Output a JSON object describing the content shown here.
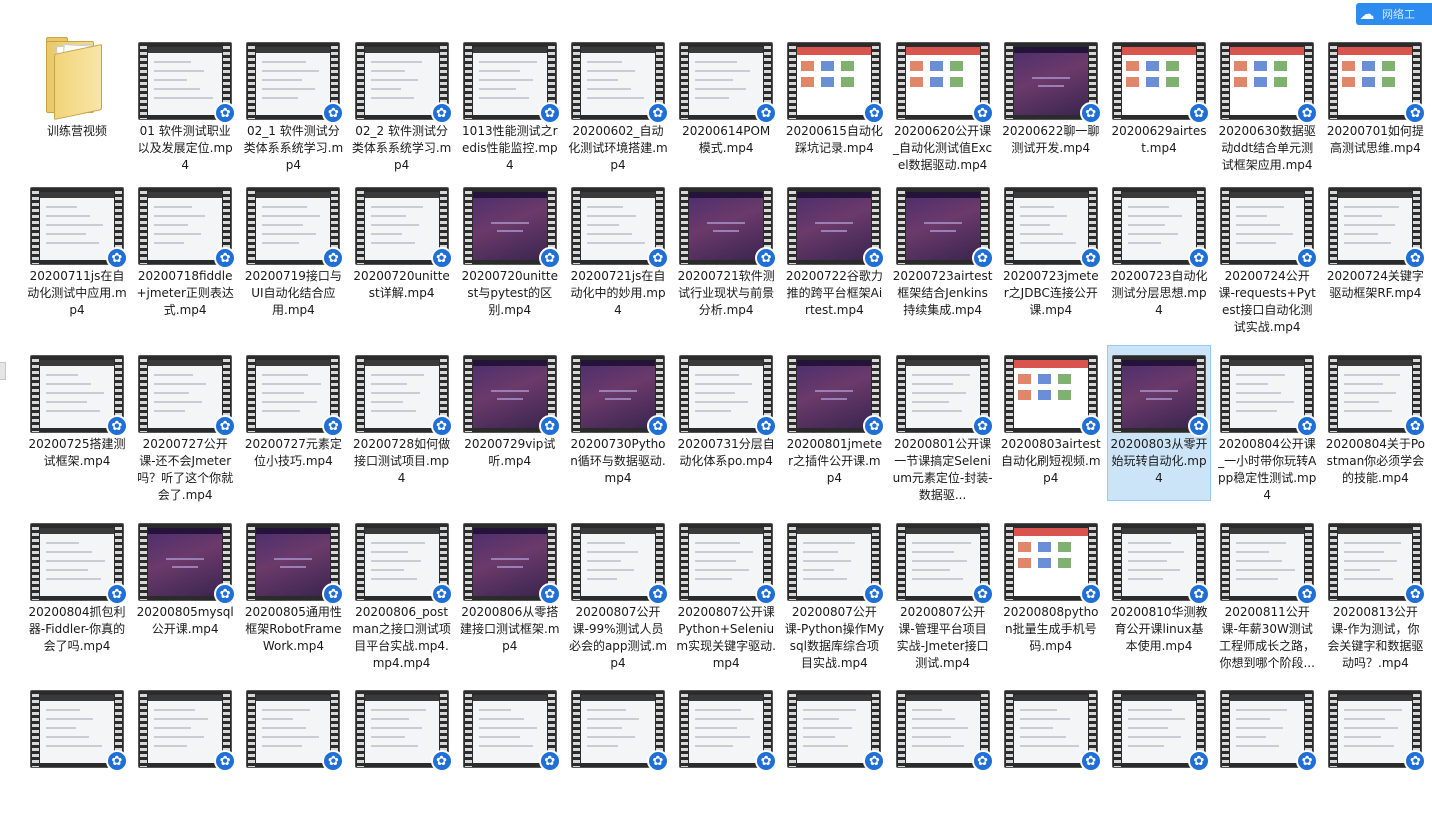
{
  "widget": {
    "icon": "cloud-icon",
    "label": "网络工"
  },
  "files": [
    {
      "name": "训练营视频",
      "type": "folder",
      "style": "folder"
    },
    {
      "name": "01 软件测试职业以及发展定位.mp4",
      "type": "video",
      "style": "light"
    },
    {
      "name": "02_1 软件测试分类体系系统学习.mp4",
      "type": "video",
      "style": "light"
    },
    {
      "name": "02_2 软件测试分类体系系统学习.mp4",
      "type": "video",
      "style": "light"
    },
    {
      "name": "1013性能测试之redis性能监控.mp4",
      "type": "video",
      "style": "light"
    },
    {
      "name": "20200602_自动化测试环境搭建.mp4",
      "type": "video",
      "style": "light"
    },
    {
      "name": "20200614POM模式.mp4",
      "type": "video",
      "style": "light"
    },
    {
      "name": "20200615自动化踩坑记录.mp4",
      "type": "video",
      "style": "web"
    },
    {
      "name": "20200620公开课_自动化测试值Excel数据驱动.mp4",
      "type": "video",
      "style": "web"
    },
    {
      "name": "20200622聊一聊测试开发.mp4",
      "type": "video",
      "style": "dark"
    },
    {
      "name": "20200629airtest.mp4",
      "type": "video",
      "style": "web"
    },
    {
      "name": "20200630数据驱动ddt结合单元测试框架应用.mp4",
      "type": "video",
      "style": "web"
    },
    {
      "name": "20200701如何提高测试思维.mp4",
      "type": "video",
      "style": "web"
    },
    {
      "name": "20200711js在自动化测试中应用.mp4",
      "type": "video",
      "style": "light"
    },
    {
      "name": "20200718fiddle+jmeter正则表达式.mp4",
      "type": "video",
      "style": "light"
    },
    {
      "name": "20200719接口与UI自动化结合应用.mp4",
      "type": "video",
      "style": "light"
    },
    {
      "name": "20200720unittest详解.mp4",
      "type": "video",
      "style": "light"
    },
    {
      "name": "20200720unittest与pytest的区别.mp4",
      "type": "video",
      "style": "dark"
    },
    {
      "name": "20200721js在自动化中的妙用.mp4",
      "type": "video",
      "style": "light"
    },
    {
      "name": "20200721软件测试行业现状与前景分析.mp4",
      "type": "video",
      "style": "dark"
    },
    {
      "name": "20200722谷歌力推的跨平台框架Airtest.mp4",
      "type": "video",
      "style": "dark"
    },
    {
      "name": "20200723airtest框架结合Jenkins持续集成.mp4",
      "type": "video",
      "style": "dark"
    },
    {
      "name": "20200723jmeter之JDBC连接公开课.mp4",
      "type": "video",
      "style": "light"
    },
    {
      "name": "20200723自动化测试分层思想.mp4",
      "type": "video",
      "style": "light"
    },
    {
      "name": "20200724公开课-requests+Pytest接口自动化测试实战.mp4",
      "type": "video",
      "style": "light"
    },
    {
      "name": "20200724关键字驱动框架RF.mp4",
      "type": "video",
      "style": "light"
    },
    {
      "name": "20200725搭建测试框架.mp4",
      "type": "video",
      "style": "light"
    },
    {
      "name": "20200727公开课-还不会Jmeter吗？听了这个你就会了.mp4",
      "type": "video",
      "style": "light"
    },
    {
      "name": "20200727元素定位小技巧.mp4",
      "type": "video",
      "style": "light"
    },
    {
      "name": "20200728如何做接口测试项目.mp4",
      "type": "video",
      "style": "light"
    },
    {
      "name": "20200729vip试听.mp4",
      "type": "video",
      "style": "dark"
    },
    {
      "name": "20200730Python循环与数据驱动.mp4",
      "type": "video",
      "style": "dark"
    },
    {
      "name": "20200731分层自动化体系po.mp4",
      "type": "video",
      "style": "light"
    },
    {
      "name": "20200801jmeter之插件公开课.mp4",
      "type": "video",
      "style": "dark"
    },
    {
      "name": "20200801公开课一节课搞定Selenium元素定位-封装-数据驱...",
      "type": "video",
      "style": "light"
    },
    {
      "name": "20200803airtest自动化刷短视频.mp4",
      "type": "video",
      "style": "web"
    },
    {
      "name": "20200803从零开始玩转自动化.mp4",
      "type": "video",
      "style": "dark",
      "selected": true
    },
    {
      "name": "20200804公开课_一小时带你玩转App稳定性测试.mp4",
      "type": "video",
      "style": "light"
    },
    {
      "name": "20200804关于Postman你必须学会的技能.mp4",
      "type": "video",
      "style": "light"
    },
    {
      "name": "20200804抓包利器-Fiddler-你真的会了吗.mp4",
      "type": "video",
      "style": "light"
    },
    {
      "name": "20200805mysql公开课.mp4",
      "type": "video",
      "style": "dark"
    },
    {
      "name": "20200805通用性框架RobotFrameWork.mp4",
      "type": "video",
      "style": "dark"
    },
    {
      "name": "20200806_postman之接口测试项目平台实战.mp4.mp4.mp4",
      "type": "video",
      "style": "light"
    },
    {
      "name": "20200806从零搭建接口测试框架.mp4",
      "type": "video",
      "style": "dark"
    },
    {
      "name": "20200807公开课-99%测试人员必会的app测试.mp4",
      "type": "video",
      "style": "light"
    },
    {
      "name": "20200807公开课Python+Selenium实现关键字驱动.mp4",
      "type": "video",
      "style": "light"
    },
    {
      "name": "20200807公开课-Python操作Mysql数据库综合项目实战.mp4",
      "type": "video",
      "style": "light"
    },
    {
      "name": "20200807公开课-管理平台项目实战-Jmeter接口测试.mp4",
      "type": "video",
      "style": "light"
    },
    {
      "name": "20200808python批量生成手机号码.mp4",
      "type": "video",
      "style": "web"
    },
    {
      "name": "20200810华测教育公开课linux基本使用.mp4",
      "type": "video",
      "style": "light"
    },
    {
      "name": "20200811公开课-年薪30W测试工程师成长之路，你想到哪个阶段...",
      "type": "video",
      "style": "light"
    },
    {
      "name": "20200813公开课-作为测试，你会关键字和数据驱动吗？.mp4",
      "type": "video",
      "style": "light"
    },
    {
      "name": "",
      "type": "video",
      "style": "light"
    },
    {
      "name": "",
      "type": "video",
      "style": "light"
    },
    {
      "name": "",
      "type": "video",
      "style": "light"
    },
    {
      "name": "",
      "type": "video",
      "style": "light"
    },
    {
      "name": "",
      "type": "video",
      "style": "light"
    },
    {
      "name": "",
      "type": "video",
      "style": "light"
    },
    {
      "name": "",
      "type": "video",
      "style": "light"
    },
    {
      "name": "",
      "type": "video",
      "style": "light"
    },
    {
      "name": "",
      "type": "video",
      "style": "light"
    },
    {
      "name": "",
      "type": "video",
      "style": "light"
    },
    {
      "name": "",
      "type": "video",
      "style": "light"
    },
    {
      "name": "",
      "type": "video",
      "style": "light"
    },
    {
      "name": "",
      "type": "video",
      "style": "light"
    }
  ]
}
